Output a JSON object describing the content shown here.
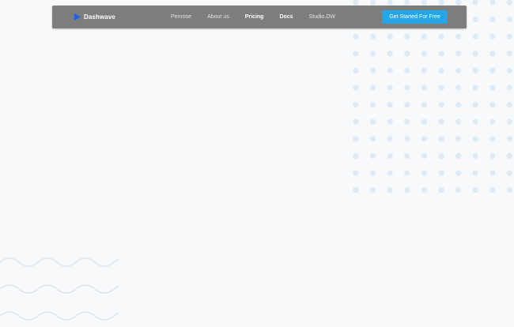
{
  "navbar": {
    "brand": {
      "name": "Dashwave",
      "icon": "play-triangle-icon"
    },
    "links": [
      {
        "label": "Penrose",
        "emphasis": false
      },
      {
        "label": "About us",
        "emphasis": false
      },
      {
        "label": "Pricing",
        "emphasis": true
      },
      {
        "label": "Docs",
        "emphasis": true
      },
      {
        "label": "Studio.DW",
        "emphasis": false
      }
    ],
    "cta_label": "Get Started For Free"
  },
  "colors": {
    "page_background": "#f8f9fa",
    "navbar_background": "#7d7d7d",
    "accent": "#24a5e8",
    "decoration": "#dcebf7"
  }
}
